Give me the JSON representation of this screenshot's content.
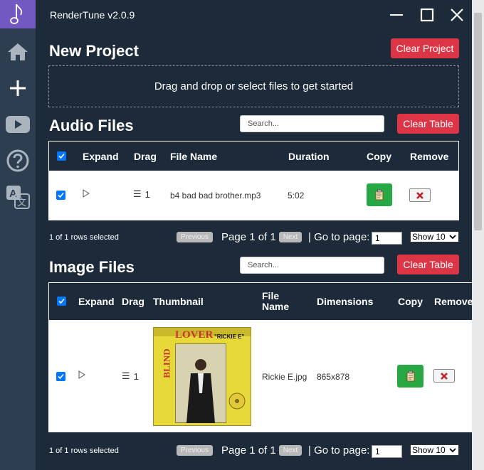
{
  "app": {
    "title": "RenderTune v2.0.9"
  },
  "sidebar": {
    "icons": [
      "music-note-icon",
      "home-icon",
      "plus-icon",
      "youtube-icon",
      "help-icon",
      "translate-icon"
    ]
  },
  "new_project": {
    "title": "New Project",
    "clear_label": "Clear Project",
    "dropzone_text": "Drag and drop or select files to get started"
  },
  "audio": {
    "title": "Audio Files",
    "search_placeholder": "Search...",
    "clear_label": "Clear Table",
    "columns": {
      "expand": "Expand",
      "drag": "Drag",
      "file_name": "File Name",
      "duration": "Duration",
      "copy": "Copy",
      "remove": "Remove"
    },
    "rows": [
      {
        "drag_index": "1",
        "file_name": "b4 bad bad brother.mp3",
        "duration": "5:02"
      }
    ],
    "footer": {
      "selected": "1 of 1 rows selected",
      "previous": "Previous",
      "page_label": "Page 1 of 1",
      "next": "Next",
      "goto_label": "| Go to page:",
      "goto_value": "1",
      "show": "Show 10"
    }
  },
  "image": {
    "title": "Image Files",
    "search_placeholder": "Search...",
    "clear_label": "Clear Table",
    "columns": {
      "expand": "Expand",
      "drag": "Drag",
      "thumbnail": "Thumbnail",
      "file_name_1": "File",
      "file_name_2": "Name",
      "dimensions": "Dimensions",
      "copy": "Copy",
      "remove": "Remove"
    },
    "rows": [
      {
        "drag_index": "1",
        "file_name": "Rickie E.jpg",
        "dimensions": "865x878",
        "thumb_text_1": "LOVER",
        "thumb_text_2": "\"RICKIE E\"",
        "thumb_text_3": "BLIND"
      }
    ],
    "footer": {
      "selected": "1 of 1 rows selected",
      "previous": "Previous",
      "page_label": "Page 1 of 1",
      "next": "Next",
      "goto_label": "| Go to page:",
      "goto_value": "1",
      "show": "Show 10"
    }
  },
  "colors": {
    "accent": "#7159c1",
    "danger": "#dc3545",
    "success": "#28a745",
    "checkbox": "#0075ff",
    "bg": "#1c2a3a",
    "sidebar": "#2c3e50"
  }
}
